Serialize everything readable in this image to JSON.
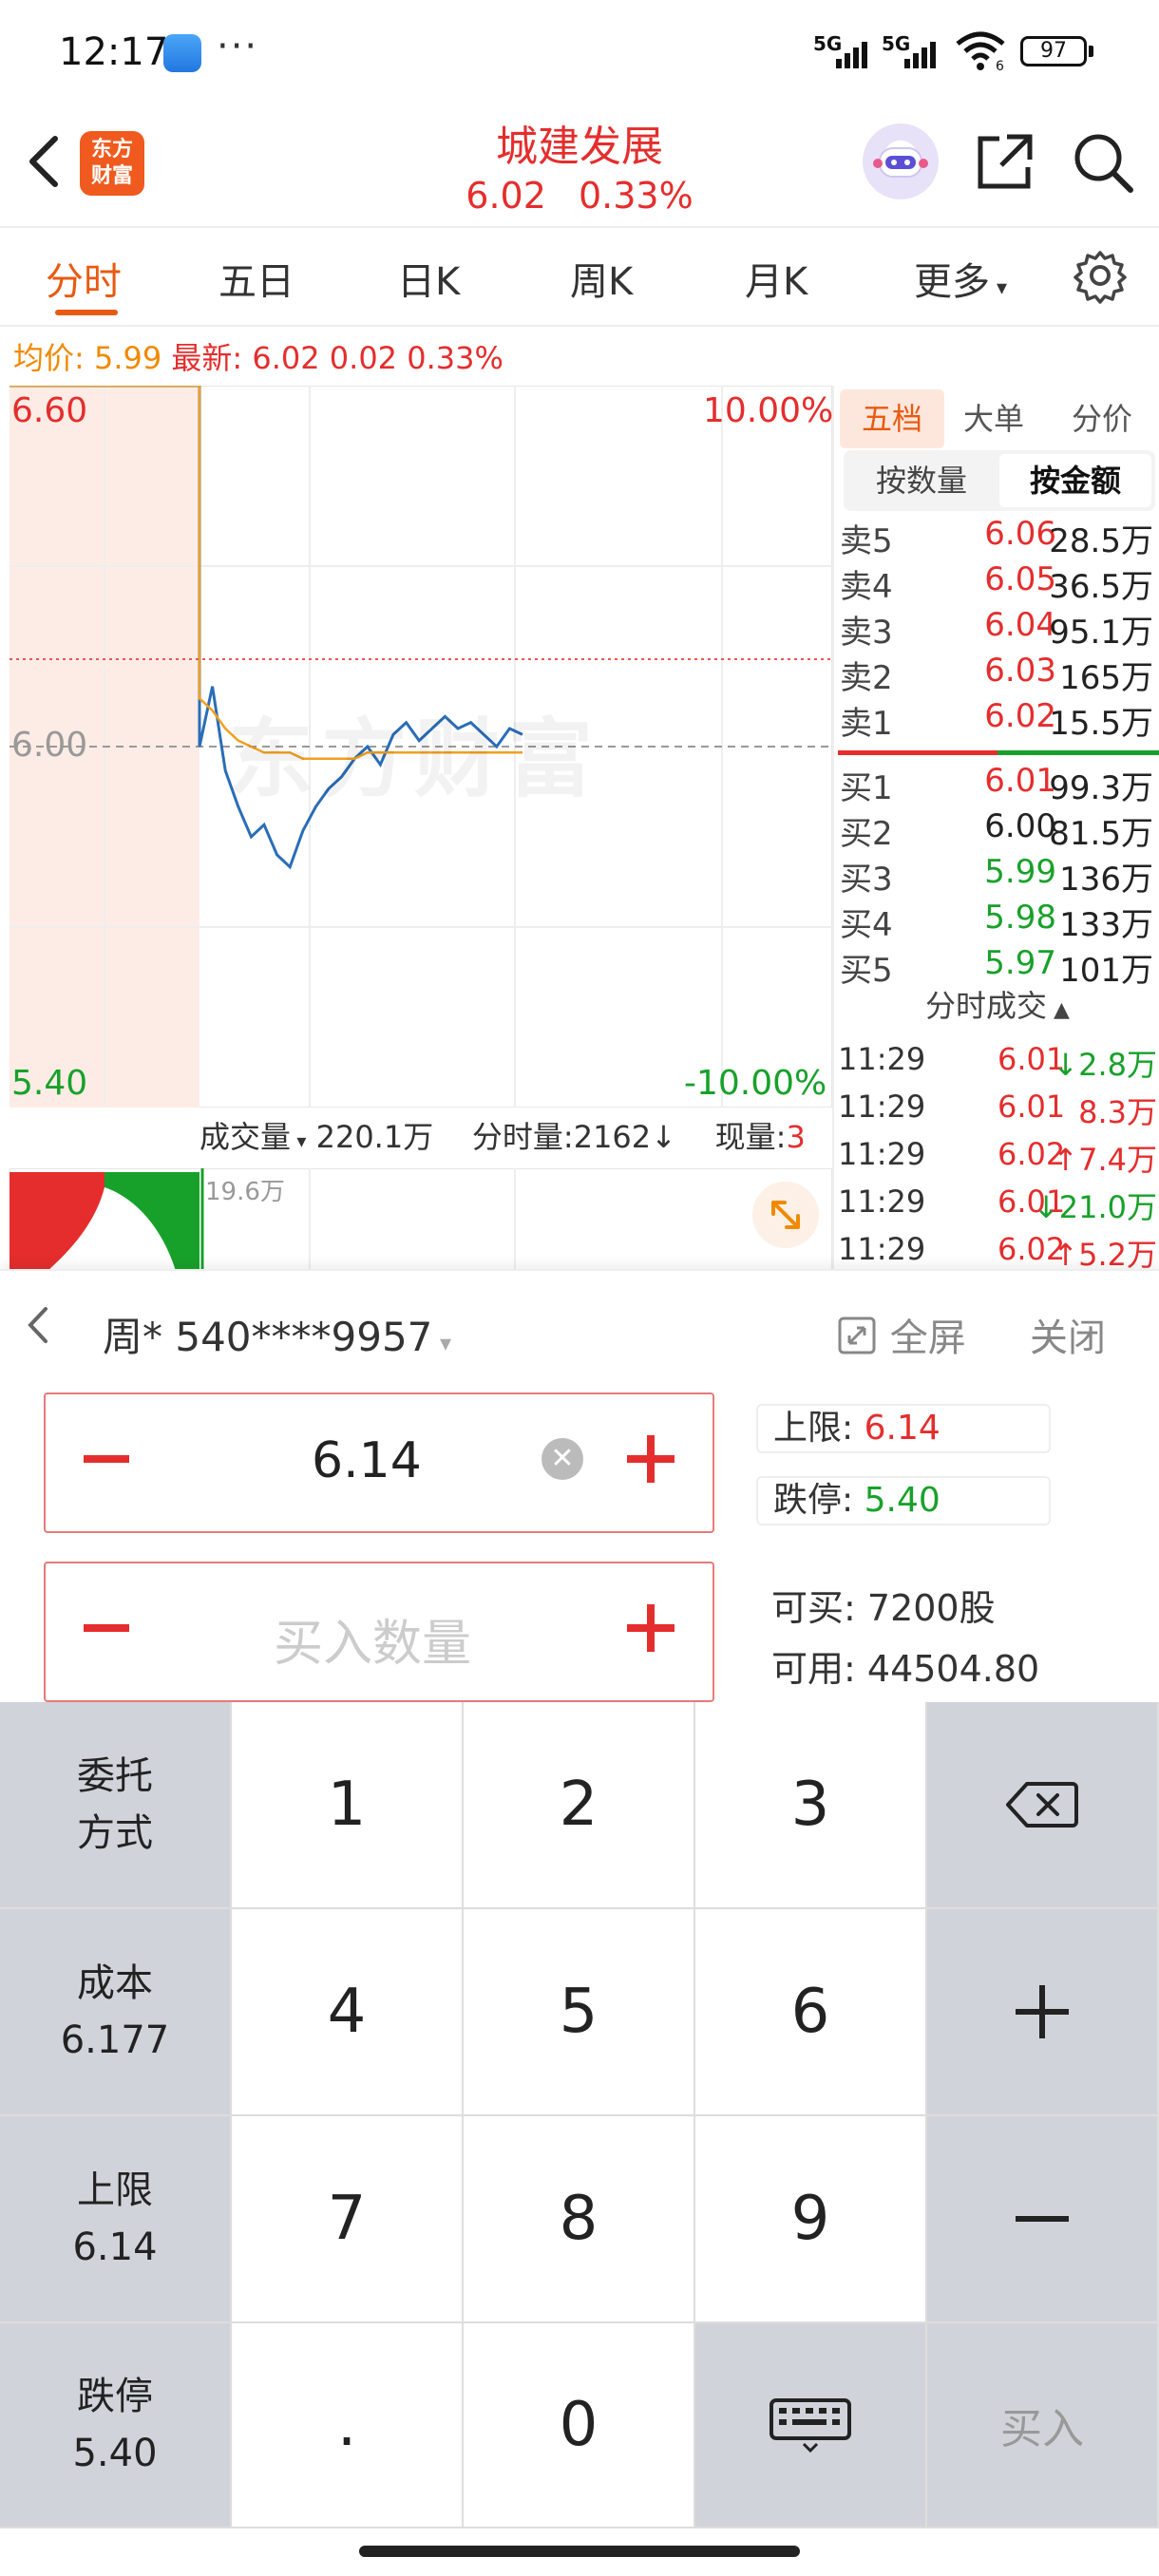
{
  "status_bar": {
    "time": "12:17",
    "more": "···",
    "signal1": "5G",
    "signal2": "5G",
    "wifi_badge": "6",
    "battery": "97"
  },
  "header": {
    "logo_text_1": "东方",
    "logo_text_2": "财富",
    "title": "城建发展",
    "price": "6.02",
    "change_pct": "0.33%"
  },
  "tabs": [
    "分时",
    "五日",
    "日K",
    "周K",
    "月K",
    "更多"
  ],
  "info": {
    "avg_label": "均价:",
    "avg": "5.99",
    "latest_label": "最新:",
    "latest": "6.02",
    "change": "0.02",
    "pct": "0.33%"
  },
  "chart": {
    "price_high": "6.60",
    "price_mid": "6.00",
    "price_low": "5.40",
    "pct_high": "10.00%",
    "pct_low": "-10.00%",
    "watermark": "东方财富",
    "volume_label": "成交量",
    "volume_total": "220.1万",
    "interval_volume_label": "分时量:",
    "interval_volume": "2162",
    "current_label": "现量:",
    "current_value": "3",
    "volume_max": "19.6万"
  },
  "chart_data": {
    "type": "line",
    "ylim": [
      5.4,
      6.6
    ],
    "series": [
      {
        "name": "最新",
        "values": [
          6.6,
          6.6,
          6.6,
          6.6,
          6.0,
          6.1,
          5.96,
          5.9,
          5.85,
          5.87,
          5.82,
          5.8,
          5.86,
          5.9,
          5.93,
          5.95,
          5.98,
          6.0,
          5.97,
          6.02,
          6.04,
          6.01,
          6.03,
          6.05,
          6.03,
          6.04,
          6.02,
          6.0,
          6.03,
          6.02
        ]
      },
      {
        "name": "均价",
        "values": [
          6.6,
          6.6,
          6.6,
          6.6,
          6.08,
          6.06,
          6.03,
          6.01,
          6.0,
          5.99,
          5.99,
          5.99,
          5.98,
          5.98,
          5.98,
          5.98,
          5.98,
          5.99,
          5.99,
          5.99,
          5.99,
          5.99,
          5.99,
          5.99,
          5.99,
          5.99,
          5.99,
          5.99,
          5.99,
          5.99
        ]
      }
    ]
  },
  "right_panel": {
    "tabs": [
      "五档",
      "大单",
      "分价"
    ],
    "segment": [
      "按数量",
      "按金额"
    ],
    "asks": [
      {
        "label": "卖5",
        "price": "6.06",
        "amount": "28.5万"
      },
      {
        "label": "卖4",
        "price": "6.05",
        "amount": "36.5万"
      },
      {
        "label": "卖3",
        "price": "6.04",
        "amount": "95.1万"
      },
      {
        "label": "卖2",
        "price": "6.03",
        "amount": "165万"
      },
      {
        "label": "卖1",
        "price": "6.02",
        "amount": "15.5万"
      }
    ],
    "bids": [
      {
        "label": "买1",
        "price": "6.01",
        "amount": "99.3万"
      },
      {
        "label": "买2",
        "price": "6.00",
        "amount": "81.5万"
      },
      {
        "label": "买3",
        "price": "5.99",
        "amount": "136万"
      },
      {
        "label": "买4",
        "price": "5.98",
        "amount": "133万"
      },
      {
        "label": "买5",
        "price": "5.97",
        "amount": "101万"
      }
    ],
    "trades_title": "分时成交",
    "trades": [
      {
        "time": "11:29",
        "price": "6.01",
        "vol": "↓2.8万",
        "dir": "down"
      },
      {
        "time": "11:29",
        "price": "6.01",
        "vol": "8.3万",
        "dir": "up"
      },
      {
        "time": "11:29",
        "price": "6.02",
        "vol": "↑7.4万",
        "dir": "up"
      },
      {
        "time": "11:29",
        "price": "6.01",
        "vol": "↓21.0万",
        "dir": "down"
      },
      {
        "time": "11:29",
        "price": "6.02",
        "vol": "↑5.2万",
        "dir": "up"
      }
    ]
  },
  "order": {
    "account": "周* 540****9957",
    "fullscreen": "全屏",
    "close": "关闭",
    "price_value": "6.14",
    "qty_placeholder": "买入数量",
    "upper_label": "上限:",
    "upper_value": "6.14",
    "lower_label": "跌停:",
    "lower_value": "5.40",
    "can_buy_label": "可买:",
    "can_buy": "7200股",
    "available_label": "可用:",
    "available": "44504.80"
  },
  "keypad": {
    "side": [
      {
        "l1": "委托",
        "l2": "方式"
      },
      {
        "l1": "成本",
        "l2": "6.177"
      },
      {
        "l1": "上限",
        "l2": "6.14"
      },
      {
        "l1": "跌停",
        "l2": "5.40"
      }
    ],
    "digits": [
      "1",
      "2",
      "3",
      "4",
      "5",
      "6",
      "7",
      "8",
      "9",
      ".",
      "0"
    ],
    "buy": "买入"
  }
}
